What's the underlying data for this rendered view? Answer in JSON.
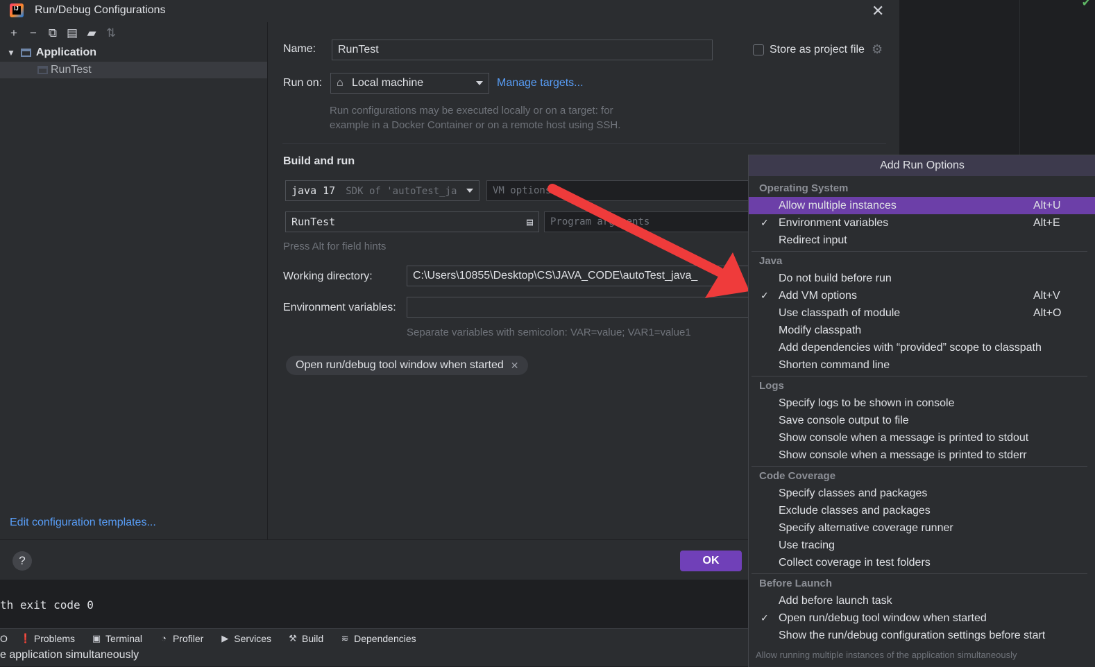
{
  "dialog": {
    "title": "Run/Debug Configurations",
    "toolbar_icons": [
      "add-icon",
      "remove-icon",
      "copy-icon",
      "save-icon",
      "folder-icon",
      "sort-icon"
    ]
  },
  "tree": {
    "group": "Application",
    "item": "RunTest",
    "edit_templates": "Edit configuration templates..."
  },
  "form": {
    "name_label": "Name:",
    "name_value": "RunTest",
    "store_label": "Store as project file",
    "run_on_label": "Run on:",
    "run_on_value": "Local machine",
    "manage_targets": "Manage targets...",
    "run_hint_1": "Run configurations may be executed locally or on a target: for",
    "run_hint_2": "example in a Docker Container or on a remote host using SSH.",
    "build_and_run": "Build and run",
    "jdk_value": "java 17",
    "jdk_hint": "SDK of 'autoTest_ja",
    "vm_placeholder": "VM options",
    "main_class": "RunTest",
    "args_placeholder": "Program arguments",
    "alt_hint": "Press Alt for field hints",
    "workdir_label": "Working directory:",
    "workdir_value": "C:\\Users\\10855\\Desktop\\CS\\JAVA_CODE\\autoTest_java_",
    "envvars_label": "Environment variables:",
    "envvars_hint": "Separate variables with semicolon: VAR=value; VAR1=value1",
    "chip_label": "Open run/debug tool window when started"
  },
  "footer": {
    "help": "?",
    "ok": "OK"
  },
  "popup": {
    "title": "Add Run Options",
    "sections": {
      "os": "Operating System",
      "java": "Java",
      "logs": "Logs",
      "coverage": "Code Coverage",
      "before": "Before Launch"
    },
    "items": {
      "allow_multiple": "Allow multiple instances",
      "allow_multiple_sc": "Alt+U",
      "env_vars": "Environment variables",
      "env_vars_sc": "Alt+E",
      "redirect": "Redirect input",
      "no_build": "Do not build before run",
      "vm_options": "Add VM options",
      "vm_options_sc": "Alt+V",
      "classpath_module": "Use classpath of module",
      "classpath_module_sc": "Alt+O",
      "modify_classpath": "Modify classpath",
      "provided_scope": "Add dependencies with “provided” scope to classpath",
      "shorten": "Shorten command line",
      "logs_console": "Specify logs to be shown in console",
      "save_output": "Save console output to file",
      "show_stdout": "Show console when a message is printed to stdout",
      "show_stderr": "Show console when a message is printed to stderr",
      "classes_packages": "Specify classes and packages",
      "exclude_classes": "Exclude classes and packages",
      "alt_runner": "Specify alternative coverage runner",
      "tracing": "Use tracing",
      "collect_tests": "Collect coverage in test folders",
      "add_task": "Add before launch task",
      "open_window": "Open run/debug tool window when started",
      "show_settings": "Show the run/debug configuration settings before start"
    },
    "hint": "Allow running multiple instances of the application simultaneously"
  },
  "ide": {
    "console_line": "th exit code 0",
    "tool_windows": [
      "O",
      "Problems",
      "Terminal",
      "Profiler",
      "Services",
      "Build",
      "Dependencies"
    ],
    "status": "e application simultaneously"
  },
  "colors": {
    "accent": "#7040b8",
    "selection": "#6c3fa8",
    "link": "#589df6",
    "arrow": "#ef3b3b"
  }
}
